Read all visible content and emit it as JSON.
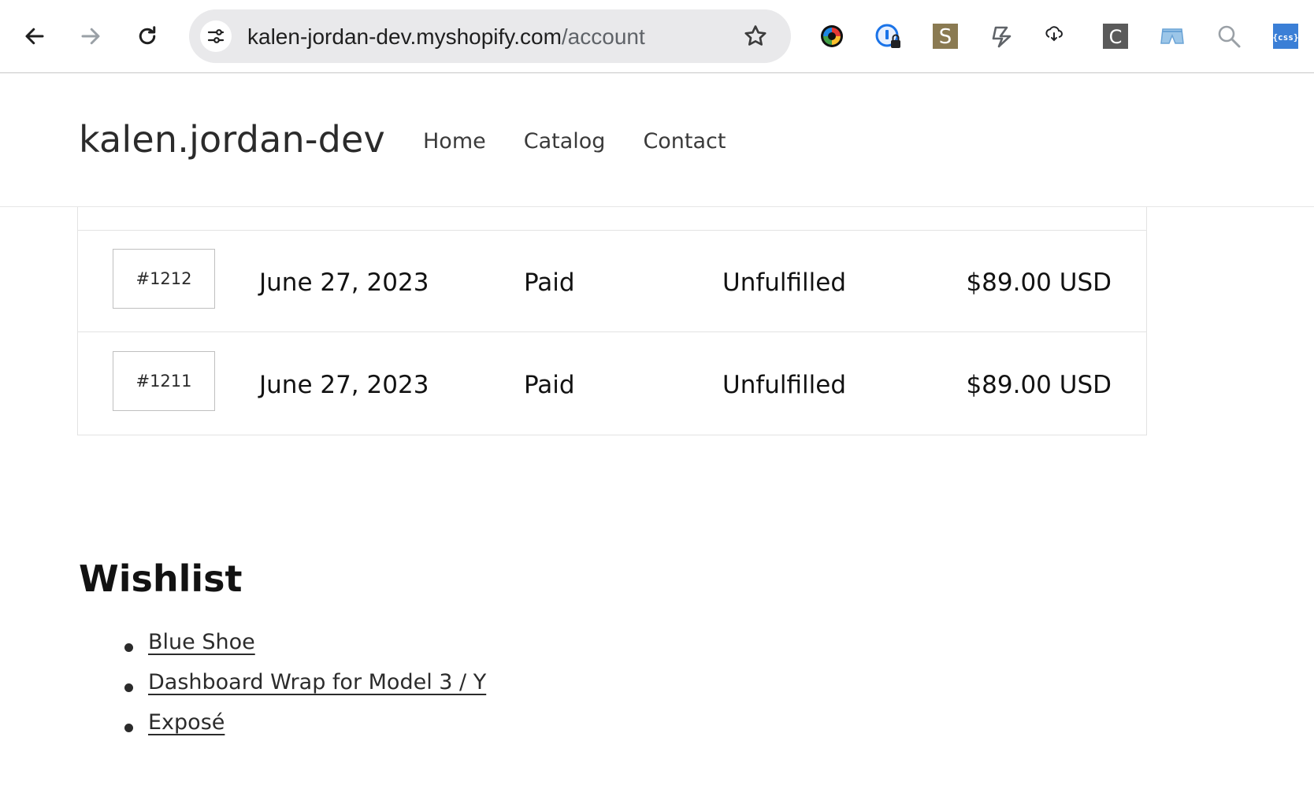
{
  "browser": {
    "url_host": "kalen-jordan-dev.myshopify.com",
    "url_path": "/account",
    "extensions": [
      "color-wheel-icon",
      "password-lock-icon",
      "s-extension-icon",
      "bolt-extension-icon",
      "cloud-download-icon",
      "c-extension-icon",
      "shorts-extension-icon",
      "search-icon",
      "css-extension-icon"
    ],
    "ext_s_letter": "S",
    "ext_c_letter": "C",
    "ext_css_text": "{css}"
  },
  "store": {
    "name": "kalen.jordan-dev",
    "menu": [
      {
        "label": "Home"
      },
      {
        "label": "Catalog"
      },
      {
        "label": "Contact"
      }
    ]
  },
  "orders": [
    {
      "id": "#1212",
      "date": "June 27, 2023",
      "payment": "Paid",
      "fulfillment": "Unfulfilled",
      "total": "$89.00 USD"
    },
    {
      "id": "#1211",
      "date": "June 27, 2023",
      "payment": "Paid",
      "fulfillment": "Unfulfilled",
      "total": "$89.00 USD"
    }
  ],
  "wishlist": {
    "title": "Wishlist",
    "items": [
      {
        "label": "Blue Shoe"
      },
      {
        "label": "Dashboard Wrap for Model 3 / Y"
      },
      {
        "label": "Exposé"
      }
    ]
  },
  "colors": {
    "s_ext_bg": "#8a7a52",
    "c_ext_bg": "#5a5a5a",
    "css_ext_bg": "#3b7fd6"
  }
}
